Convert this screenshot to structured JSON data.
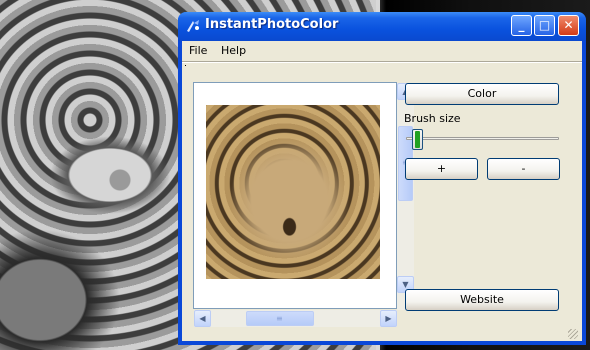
{
  "window": {
    "title": "InstantPhotoColor"
  },
  "titlebar_buttons": {
    "minimize": "_",
    "maximize": "□",
    "close": "✕"
  },
  "menu": {
    "file": "File",
    "help": "Help"
  },
  "controls": {
    "color_button": "Color",
    "brush_size_label": "Brush size",
    "brush_size_level": 0.05,
    "plus_button": "+",
    "minus_button": "-",
    "website_button": "Website"
  },
  "icons": {
    "scroll_up": "▲",
    "scroll_down": "▼",
    "scroll_left": "◀",
    "scroll_right": "▶",
    "grip": "≡"
  },
  "colors": {
    "titlebar": "#0a52de",
    "window_bg": "#ece9d8",
    "sepia_image": "#b5935c"
  }
}
